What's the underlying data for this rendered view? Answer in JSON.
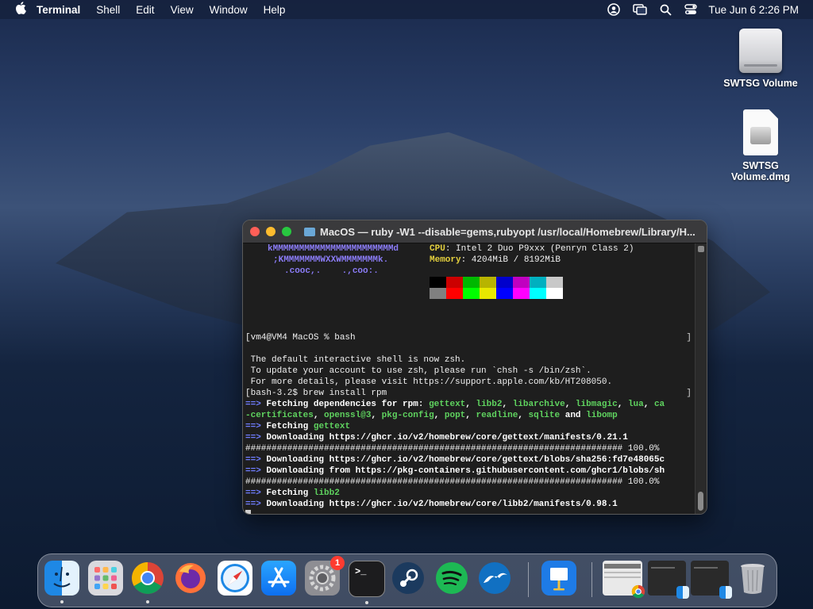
{
  "menubar": {
    "apple": "",
    "items": [
      "Terminal",
      "Shell",
      "Edit",
      "View",
      "Window",
      "Help"
    ],
    "clock": "Tue Jun 6  2:26 PM",
    "status_icons": [
      "user-icon",
      "screen-mirroring-icon",
      "search-icon",
      "control-center-icon"
    ]
  },
  "desktop": {
    "volume_label": "SWTSG Volume",
    "dmg_label_line1": "SWTSG",
    "dmg_label_line2": "Volume.dmg"
  },
  "terminal": {
    "title": "MacOS — ruby -W1 --disable=gems,rubyopt /usr/local/Homebrew/Library/H...",
    "neofetch_art": [
      "kMMMMMMMMMMMMMMMMMMMMMMMd",
      ";KMMMMMMMWXXWMMMMMMMk.",
      ".cooc,.    .,coo:."
    ],
    "cpu_key": "CPU",
    "cpu_value": ": Intel 2 Duo P9xxx (Penryn Class 2)",
    "memory_key": "Memory",
    "memory_value": ": 4204MiB / 8192MiB",
    "palette_top": [
      "#000000",
      "#cc0000",
      "#00b800",
      "#b8b400",
      "#0000cc",
      "#c000c0",
      "#00b0c0",
      "#c8c8c8"
    ],
    "palette_bottom": [
      "#808080",
      "#ff0000",
      "#00ff00",
      "#e8e800",
      "#0000ff",
      "#ff00ff",
      "#00ffff",
      "#ffffff"
    ],
    "prompt1": "[vm4@VM4 MacOS % bash",
    "bracket": "]",
    "default_shell_1": " The default interactive shell is now zsh.",
    "default_shell_2": " To update your account to use zsh, please run `chsh -s /bin/zsh`.",
    "default_shell_3": " For more details, please visit https://support.apple.com/kb/HT208050.",
    "prompt2": "[bash-3.2$ brew install rpm",
    "arrow": "==>",
    "fetch_deps_label": " Fetching dependencies for rpm:",
    "deps_line1": [
      "gettext",
      "libb2",
      "libarchive",
      "libmagic",
      "lua",
      "ca"
    ],
    "deps_line2_start": "-certificates",
    "deps_line2": [
      "openssl@3",
      "pkg-config",
      "popt",
      "readline",
      "sqlite"
    ],
    "deps_and": "and",
    "deps_last": "libomp",
    "fetching_label": " Fetching",
    "gettext": "gettext",
    "dl1": " Downloading https://ghcr.io/v2/homebrew/core/gettext/manifests/0.21.1",
    "progress1": "######################################################################## 100.0%",
    "dl2": " Downloading https://ghcr.io/v2/homebrew/core/gettext/blobs/sha256:fd7e48065c",
    "dl3": " Downloading from https://pkg-containers.githubusercontent.com/ghcr1/blobs/sh",
    "progress2": "######################################################################## 100.0%",
    "libb2": "libb2",
    "dl4": " Downloading https://ghcr.io/v2/homebrew/core/libb2/manifests/0.98.1"
  },
  "dock": {
    "apps": [
      "Finder",
      "Launchpad",
      "Google Chrome",
      "Firefox",
      "Safari",
      "App Store",
      "System Preferences",
      "Terminal",
      "Steam",
      "Spotify",
      "OpenOffice",
      "Keynote"
    ],
    "system_preferences_badge": "1",
    "terminal_icon_text": ">_"
  }
}
